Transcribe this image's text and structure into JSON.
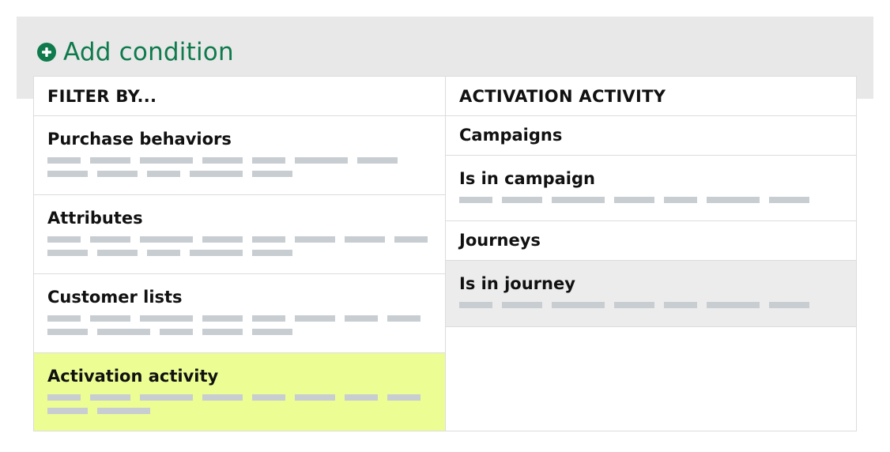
{
  "add_condition": {
    "label": "Add condition",
    "icon": "plus-circle-icon",
    "color": "#0f7a4c"
  },
  "filter_panel": {
    "header": "FILTER BY...",
    "items": [
      {
        "label": "Purchase behaviors"
      },
      {
        "label": "Attributes"
      },
      {
        "label": "Customer lists"
      },
      {
        "label": "Activation activity",
        "selected": true
      }
    ]
  },
  "activation_panel": {
    "header": "ACTIVATION ACTIVITY",
    "items": [
      {
        "label": "Campaigns"
      },
      {
        "label": "Is in campaign"
      },
      {
        "label": "Journeys"
      },
      {
        "label": "Is in journey",
        "highlighted": true
      }
    ]
  },
  "colors": {
    "selected_bg": "#ecfd94",
    "highlight_bg": "#ececec",
    "band_bg": "#e8e8e8"
  }
}
